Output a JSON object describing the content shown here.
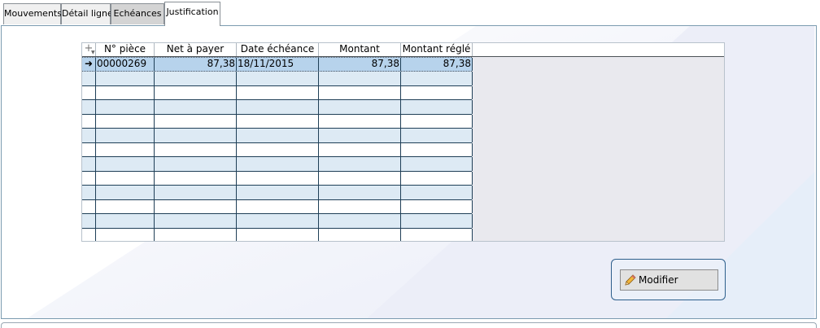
{
  "tabs": [
    {
      "label": "Mouvements",
      "state": "normal"
    },
    {
      "label": "Détail ligne",
      "state": "normal"
    },
    {
      "label": "Echéances",
      "state": "grey"
    },
    {
      "label": "Justification",
      "state": "active"
    }
  ],
  "grid": {
    "add_icon": "+",
    "columns": [
      "N° pièce",
      "Net à payer",
      "Date échéance",
      "Montant",
      "Montant réglé"
    ],
    "selected_marker_icon": "arrow-right-icon",
    "rows": [
      {
        "piece": "00000269",
        "net": "87,38",
        "date": "18/11/2015",
        "montant": "87,38",
        "regle": "87,38"
      }
    ],
    "empty_row_count": 12
  },
  "actions": {
    "modifier_label": "Modifier",
    "modifier_icon": "pencil-icon"
  },
  "colors": {
    "row_selected": "#b7d3ec",
    "row_alt": "#ddeaf4",
    "grid_line": "#1f3f57",
    "panel_border": "#7b9bb0"
  }
}
